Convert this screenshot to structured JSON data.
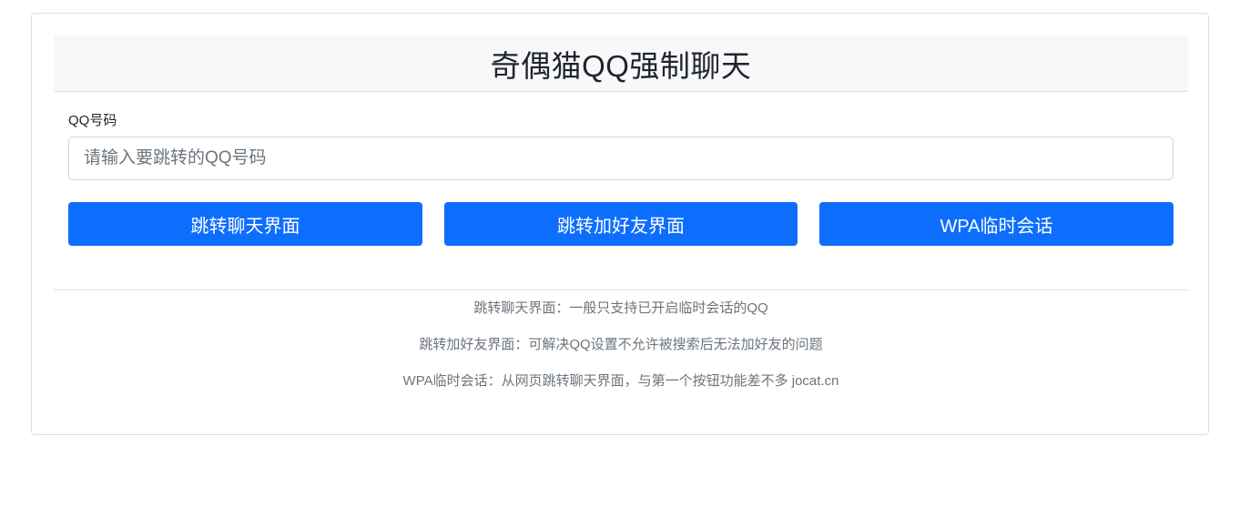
{
  "header": {
    "title": "奇偶猫QQ强制聊天"
  },
  "form": {
    "qq_label": "QQ号码",
    "qq_value": "",
    "qq_placeholder": "请输入要跳转的QQ号码"
  },
  "buttons": {
    "chat_label": "跳转聊天界面",
    "add_friend_label": "跳转加好友界面",
    "wpa_label": "WPA临时会话"
  },
  "notes": [
    "跳转聊天界面：一般只支持已开启临时会话的QQ",
    "跳转加好友界面：可解决QQ设置不允许被搜索后无法加好友的问题",
    "WPA临时会话：从网页跳转聊天界面，与第一个按钮功能差不多 jocat.cn"
  ],
  "colors": {
    "primary": "#0d6efd",
    "header_bg": "#f7f8f9",
    "muted_text": "#6c757d"
  }
}
